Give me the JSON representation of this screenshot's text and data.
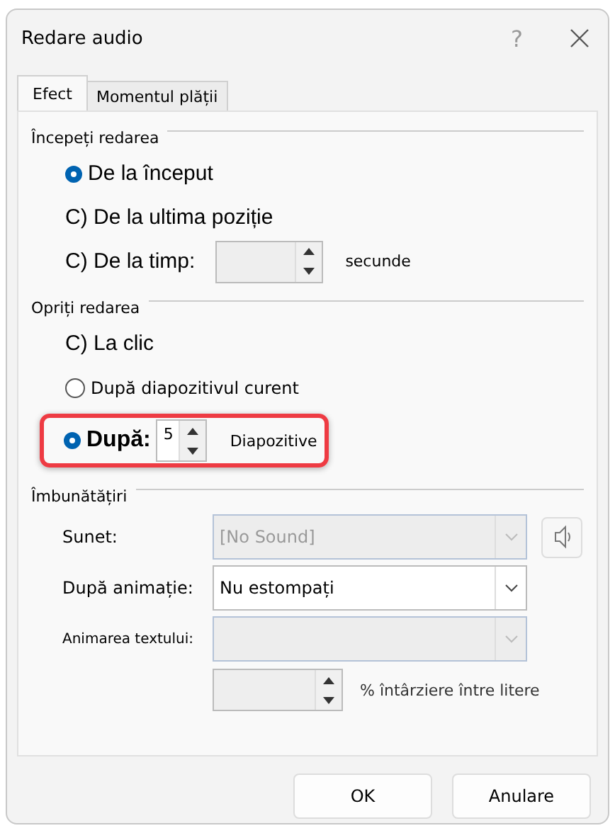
{
  "window": {
    "title": "Redare audio",
    "help": "?"
  },
  "tabs": [
    {
      "label": "Efect",
      "selected": true
    },
    {
      "label": "Momentul plății",
      "selected": false
    }
  ],
  "start_group": {
    "title": "Începeți redarea",
    "options": [
      {
        "kind": "radio",
        "label": "De la început",
        "selected": true
      },
      {
        "kind": "text",
        "label": "C) De la ultima poziție"
      },
      {
        "kind": "spin",
        "label": "C) De la timp:",
        "unit": "secunde"
      }
    ]
  },
  "stop_group": {
    "title": "Opriți redarea",
    "options": [
      {
        "kind": "text",
        "label": "C) La clic"
      },
      {
        "kind": "radio_small",
        "label": "După diapozitivul curent",
        "selected": false
      },
      {
        "kind": "radio_spin",
        "label": "După:",
        "selected": true,
        "value": "5",
        "unit": "Diapozitive",
        "highlighted": true
      }
    ]
  },
  "enhance_group": {
    "title": "Îmbunătățiri",
    "sound": {
      "label": "Sunet:",
      "value": "[No Sound]",
      "disabled": true
    },
    "after_animation": {
      "label": "După animație:",
      "value": "Nu estompați",
      "disabled": false
    },
    "text_animation": {
      "label": "Animarea textului:",
      "disabled": true
    },
    "delay": {
      "unit": "% întârziere între litere",
      "disabled": true
    }
  },
  "buttons": [
    {
      "label": "OK"
    },
    {
      "label": "Anulare"
    }
  ]
}
